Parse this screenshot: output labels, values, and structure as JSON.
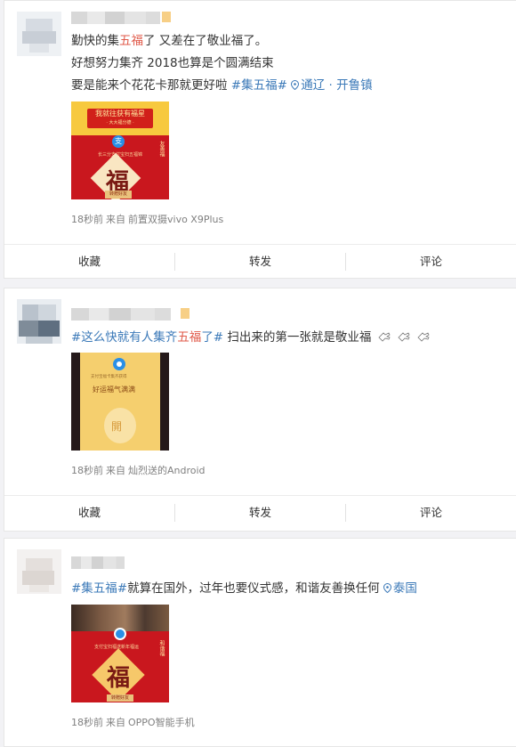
{
  "posts": [
    {
      "lines": [
        {
          "a": "勤快的集",
          "b": "五福",
          "c": "了 又差在了敬业福了。"
        },
        {
          "a": "好想努力集齐 2018也算是个圆满结束"
        }
      ],
      "line3": {
        "text": "要是能来个花花卡那就更好啦 ",
        "tag": "#集五福#",
        "loc": "通辽 · 开鲁镇"
      },
      "thumb": {
        "plate_l1": "我就往获有福星",
        "plate_l2": "· 大大福分德 ·",
        "logo": "支",
        "sub": "长三分支付宝扫五福锦",
        "fu": "福",
        "side": "友善福",
        "btm": "转赠好友"
      },
      "meta": {
        "time": "18秒前",
        "from": "来自",
        "device": "前置双摄vivo X9Plus"
      }
    },
    {
      "tag_a": "#这么快就有人集齐",
      "tag_b": "五福",
      "tag_c": "了#",
      "text": " 扫出来的第一张就是敬业福",
      "thumb": {
        "line1": "支付宝福卡集齐获得",
        "line2": "好运福气满满",
        "kai": "開"
      },
      "meta": {
        "time": "18秒前",
        "from": "来自",
        "device": "灿烈送的Android"
      }
    },
    {
      "tag": "#集五福#",
      "text": "就算在国外，过年也要仪式感，和谐友善换任何 ",
      "loc": "泰国",
      "thumb": {
        "sub": "支付宝扫福送新年福运",
        "fu": "福",
        "side": "和谐福",
        "btm": "转赠好友"
      },
      "meta": {
        "time": "18秒前",
        "from": "来自",
        "device": "OPPO智能手机"
      }
    }
  ],
  "actions": {
    "fav": "收藏",
    "repost": "转发",
    "comment": "评论"
  },
  "colors": {
    "tag": "#3b79b8",
    "highlight": "#e05a4a",
    "meta": "#808080"
  },
  "icons": {
    "location": "location-pin-icon",
    "emoji": "pointing-hand-emoji"
  }
}
